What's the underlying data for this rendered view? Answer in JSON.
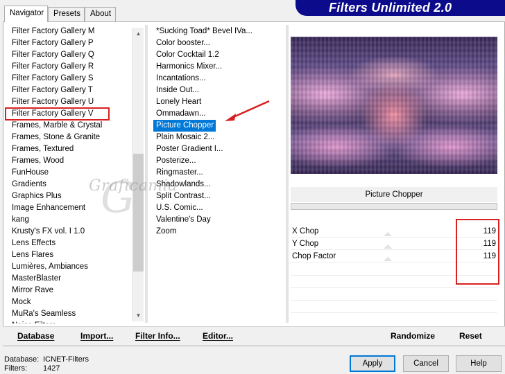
{
  "tabs": [
    {
      "label": "Navigator",
      "active": true
    },
    {
      "label": "Presets",
      "active": false
    },
    {
      "label": "About",
      "active": false
    }
  ],
  "banner": {
    "title": "Filters Unlimited 2.0"
  },
  "categories": {
    "items": [
      "Filter Factory Gallery M",
      "Filter Factory Gallery P",
      "Filter Factory Gallery Q",
      "Filter Factory Gallery R",
      "Filter Factory Gallery S",
      "Filter Factory Gallery T",
      "Filter Factory Gallery U",
      "Filter Factory Gallery V",
      "Frames, Marble & Crystal",
      "Frames, Stone & Granite",
      "Frames, Textured",
      "Frames, Wood",
      "FunHouse",
      "Gradients",
      "Graphics Plus",
      "Image Enhancement",
      "kang",
      "Krusty's FX vol. I 1.0",
      "Lens Effects",
      "Lens Flares",
      "Lumières, Ambiances",
      "MasterBlaster",
      "Mirror Rave",
      "Mock",
      "MuRa's Seamless",
      "Noise Filters"
    ],
    "highlighted": "Filter Factory Gallery V"
  },
  "filters": {
    "items": [
      "*Sucking Toad*  Bevel IVa...",
      "Color booster...",
      "Color Cocktail 1.2",
      "Harmonics Mixer...",
      "Incantations...",
      "Inside Out...",
      "Lonely Heart",
      "Ommadawn...",
      "Picture Chopper",
      "Plain Mosaic 2...",
      "Poster Gradient I...",
      "Posterize...",
      "Ringmaster...",
      "Shadowlands...",
      "Split Contrast...",
      "U.S. Comic...",
      "Valentine's Day",
      "Zoom"
    ],
    "selected": "Picture Chopper"
  },
  "preview": {
    "filter_name": "Picture Chopper",
    "progress": 0
  },
  "params": [
    {
      "label": "X Chop",
      "value": "119"
    },
    {
      "label": "Y Chop",
      "value": "119"
    },
    {
      "label": "Chop Factor",
      "value": "119"
    }
  ],
  "bottom_links": {
    "database": "Database",
    "import": "Import...",
    "filter_info": "Filter Info...",
    "editor": "Editor...",
    "randomize": "Randomize",
    "reset": "Reset"
  },
  "status": {
    "database_label": "Database:",
    "database_value": "ICNET-Filters",
    "filters_label": "Filters:",
    "filters_value": "1427"
  },
  "buttons": {
    "apply": "Apply",
    "cancel": "Cancel",
    "help": "Help"
  },
  "watermark": {
    "text": "Graficamia",
    "initial": "G"
  },
  "colors": {
    "selection": "#0078d7",
    "banner": "#0b0b8c",
    "annotation": "#d91f1f"
  }
}
